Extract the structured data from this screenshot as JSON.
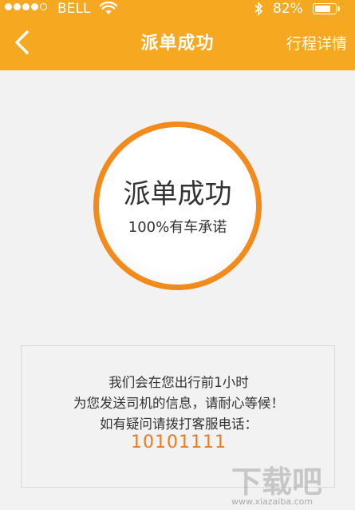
{
  "status_bar": {
    "carrier": "BELL",
    "battery_percent": "82%",
    "battery_level": 0.82,
    "signal_bars_filled": 4,
    "signal_bars_total": 5
  },
  "nav": {
    "title": "派单成功",
    "right_action": "行程详情",
    "back_icon": "chevron-left-icon"
  },
  "status_circle": {
    "title": "派单成功",
    "subtitle": "100%有车承诺"
  },
  "info": {
    "line1": "我们会在您出行前1小时",
    "line2": "为您发送司机的信息，请耐心等候！",
    "line3": "如有疑问请拨打客服电话：",
    "phone": "10101111"
  },
  "watermark": {
    "logo": "下载吧",
    "url": "www.xiazaiba.com"
  },
  "colors": {
    "accent": "#f5a820",
    "phone": "#f07a1a",
    "background": "#f2f2f2"
  }
}
